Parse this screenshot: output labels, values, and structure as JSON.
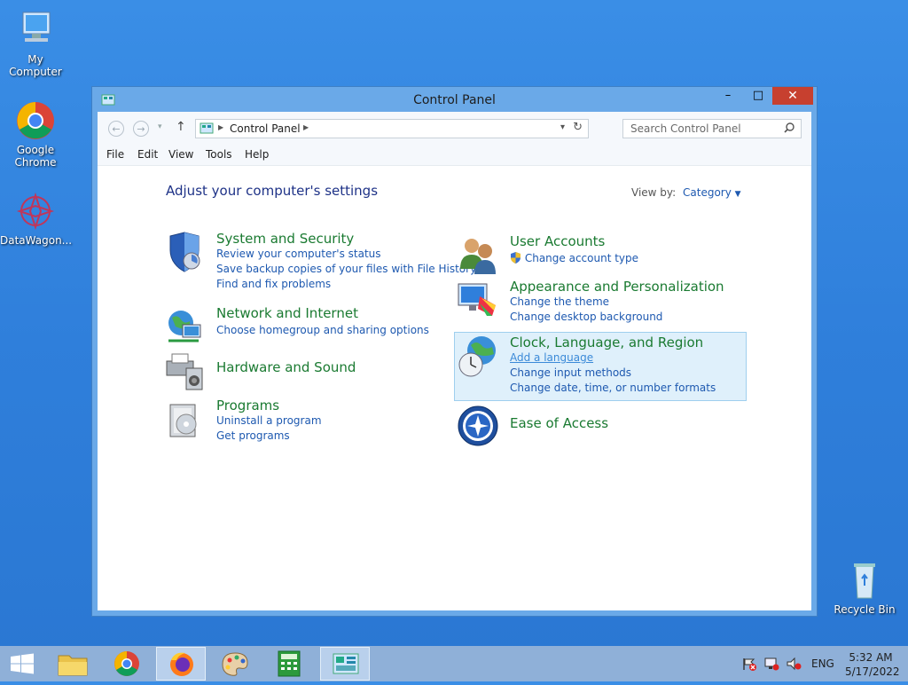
{
  "desktop": {
    "icons": [
      {
        "label": "My Computer"
      },
      {
        "label": "Google Chrome"
      },
      {
        "label": "DataWagon..."
      },
      {
        "label": "Recycle Bin"
      }
    ]
  },
  "window": {
    "title": "Control Panel",
    "buttons": {
      "minimize": "–",
      "maximize": "□",
      "close": "✕"
    }
  },
  "nav": {
    "back": "←",
    "forward": "→",
    "up": "↑",
    "breadcrumb": "Control Panel",
    "search_placeholder": "Search Control Panel"
  },
  "menu": [
    "File",
    "Edit",
    "View",
    "Tools",
    "Help"
  ],
  "content": {
    "heading": "Adjust your computer's settings",
    "view_by_label": "View by:",
    "view_by_value": "Category",
    "categories": [
      {
        "title": "System and Security",
        "links": [
          "Review your computer's status",
          "Save backup copies of your files with File History",
          "Find and fix problems"
        ]
      },
      {
        "title": "Network and Internet",
        "links": [
          "Choose homegroup and sharing options"
        ]
      },
      {
        "title": "Hardware and Sound",
        "links": []
      },
      {
        "title": "Programs",
        "links": [
          "Uninstall a program",
          "Get programs"
        ]
      },
      {
        "title": "User Accounts",
        "links": [
          "Change account type"
        ]
      },
      {
        "title": "Appearance and Personalization",
        "links": [
          "Change the theme",
          "Change desktop background"
        ]
      },
      {
        "title": "Clock, Language, and Region",
        "links": [
          "Add a language",
          "Change input methods",
          "Change date, time, or number formats"
        ]
      },
      {
        "title": "Ease of Access",
        "links": []
      }
    ]
  },
  "taskbar": {
    "lang": "ENG",
    "time": "5:32 AM",
    "date": "5/17/2022"
  }
}
